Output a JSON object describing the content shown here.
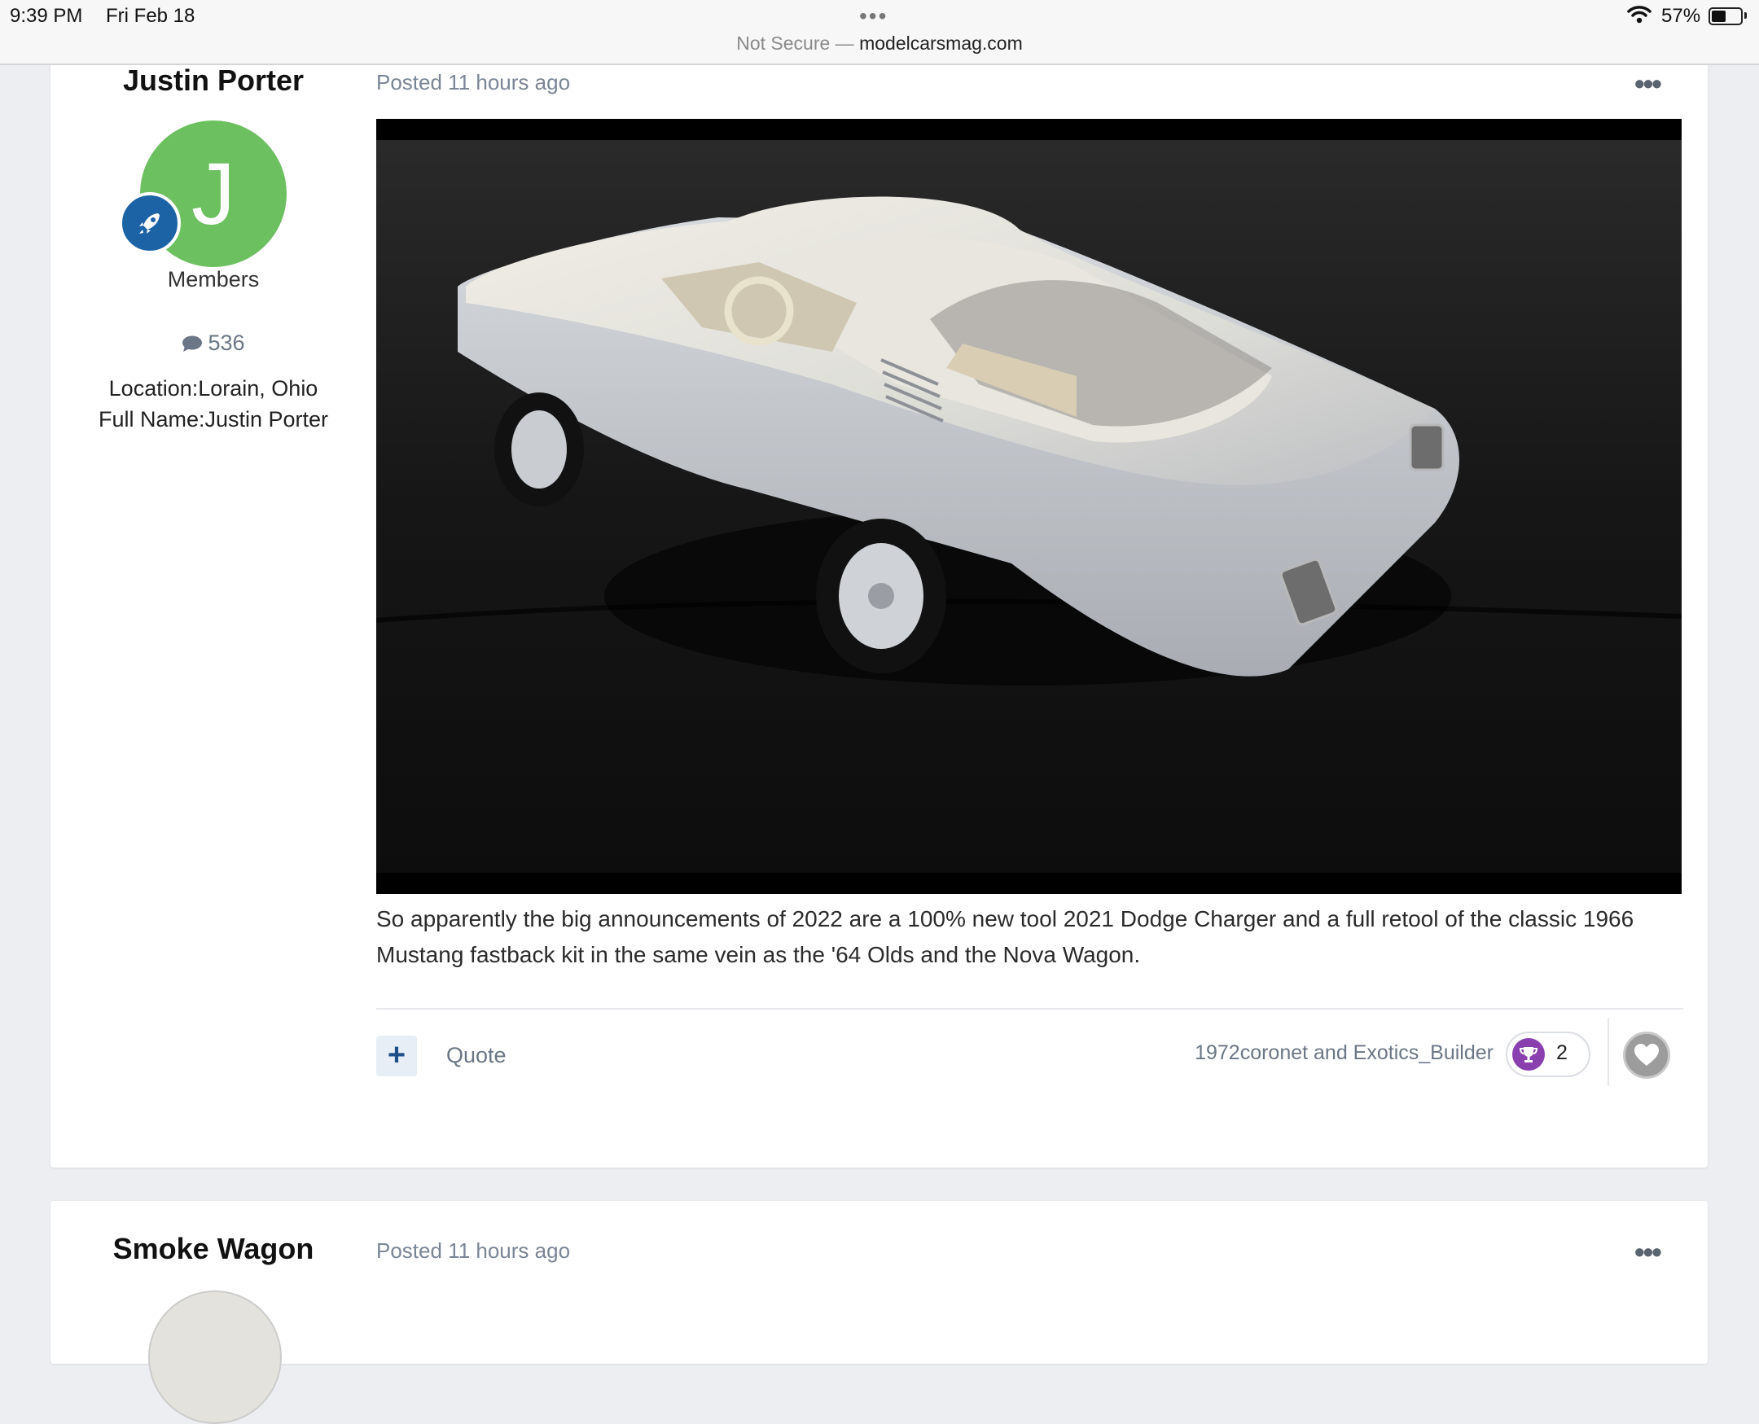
{
  "status_bar": {
    "time": "9:39 PM",
    "date": "Fri Feb 18",
    "battery_pct": "57%",
    "battery_level": 0.57,
    "url_prefix": "Not Secure —",
    "domain": "modelcarsmag.com"
  },
  "posts": [
    {
      "author": "Justin Porter",
      "avatar_letter": "J",
      "avatar_color": "#6cc060",
      "rank_icon": "rocket-icon",
      "group": "Members",
      "post_count": "536",
      "location": "Location:Lorain, Ohio",
      "full_name": "Full Name:Justin Porter",
      "posted": "Posted 11 hours ago",
      "more_label": "•••",
      "body": "So apparently the big announcements of 2022 are a 100% new tool 2021 Dodge Charger and a full retool of the classic 1966 Mustang fastback kit in the same vein as the '64 Olds and the Nova Wagon.",
      "plus_label": "+",
      "quote_label": "Quote",
      "reactors": "1972coronet and Exotics_Builder",
      "reaction_icon": "trophy-icon",
      "reaction_count": "2",
      "like_icon": "heart-icon"
    },
    {
      "author": "Smoke Wagon",
      "posted": "Posted 11 hours ago",
      "more_label": "•••"
    }
  ],
  "colors": {
    "page_bg": "#eceef1",
    "accent_blue": "#1c63a6",
    "trophy_purple": "#8a3fae"
  }
}
